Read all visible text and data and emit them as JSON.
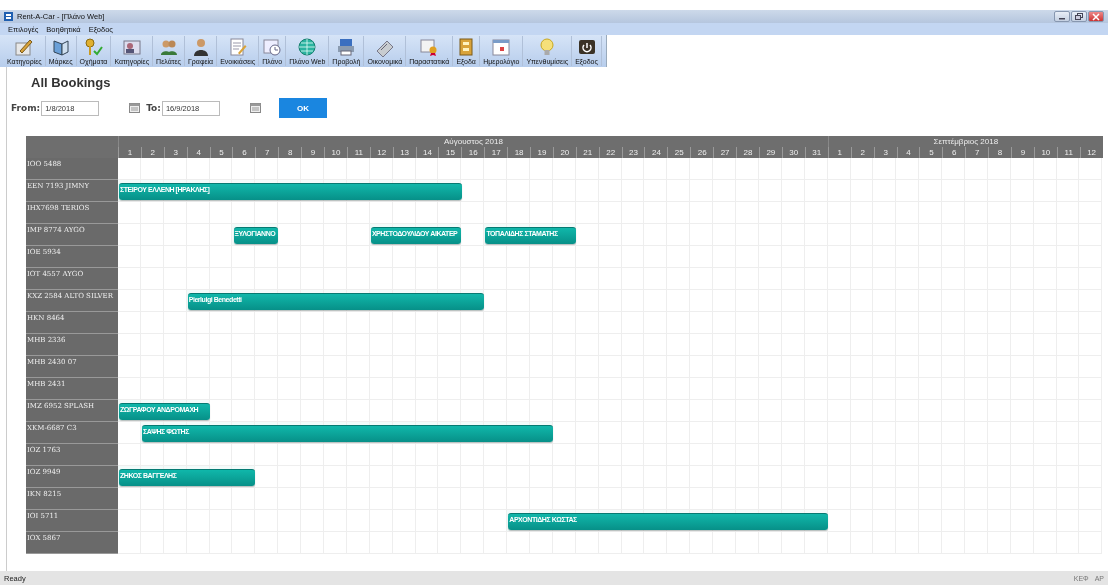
{
  "window": {
    "title": "Rent-A-Car - [Πλάνο Web]"
  },
  "menu": [
    "Επιλογές",
    "Βοηθητικά",
    "Εξοδος"
  ],
  "toolbar": [
    "Κατηγορίες",
    "Μάρκες",
    "Οχήματα",
    "Κατηγορίες",
    "Πελάτες",
    "Γραφεία",
    "Ενοικιάσεις",
    "Πλάνο",
    "Πλάνο Web",
    "Προβολή",
    "Οικονομικά",
    "Παραστατικά",
    "Εξοδα",
    "Ημερολόγιο",
    "Υπενθυμίσεις",
    "Εξοδος"
  ],
  "page": {
    "title": "All Bookings"
  },
  "filter": {
    "from_label": "From:",
    "from_value": "1/8/2018",
    "to_label": "To:",
    "to_value": "16/9/2018",
    "ok_button": "OK"
  },
  "schedule": {
    "months": [
      {
        "label": "Αύγουστος 2018",
        "days": [
          "1",
          "2",
          "3",
          "4",
          "5",
          "6",
          "7",
          "8",
          "9",
          "10",
          "11",
          "12",
          "13",
          "14",
          "15",
          "16",
          "17",
          "18",
          "19",
          "20",
          "21",
          "22",
          "23",
          "24",
          "25",
          "26",
          "27",
          "28",
          "29",
          "30",
          "31"
        ]
      },
      {
        "label": "Σεπτέμβριος 2018",
        "days": [
          "1",
          "2",
          "3",
          "4",
          "5",
          "6",
          "7",
          "8",
          "9",
          "10",
          "11",
          "12"
        ]
      }
    ],
    "rows": [
      {
        "vehicle": "IOO 5488",
        "bookings": [],
        "booked_days": [
          false,
          false,
          false,
          false,
          false,
          false,
          false,
          false,
          false,
          false,
          false,
          false,
          false,
          false,
          false,
          false,
          false,
          false,
          false,
          false,
          false,
          false,
          false,
          false,
          false,
          false,
          false,
          false,
          false,
          false,
          false,
          false,
          false,
          false,
          false,
          false,
          false,
          false,
          false,
          false,
          false,
          false,
          false
        ]
      },
      {
        "vehicle": "EEN 7193 JIMNY",
        "bookings": [
          {
            "customer": "ΣΤΕΙΡΟΥ ΕΛΛΕΝΗ [ΗΡΑΚΛΗΣ]"
          }
        ],
        "booked_days": [
          true,
          true,
          true,
          true,
          true,
          true,
          true,
          true,
          true,
          true,
          true,
          true,
          true,
          true,
          true,
          false,
          false,
          false,
          false,
          false,
          false,
          false,
          false,
          false,
          false,
          false,
          false,
          false,
          false,
          false,
          false,
          false,
          false,
          false,
          false,
          false,
          false,
          false,
          false,
          false,
          false,
          false,
          false
        ]
      },
      {
        "vehicle": "IHX7698 TERIOS",
        "bookings": [],
        "booked_days": [
          false,
          false,
          false,
          false,
          false,
          false,
          false,
          false,
          false,
          false,
          false,
          false,
          false,
          false,
          false,
          false,
          false,
          false,
          false,
          false,
          false,
          false,
          false,
          false,
          false,
          false,
          false,
          false,
          false,
          false,
          false,
          false,
          false,
          false,
          false,
          false,
          false,
          false,
          false,
          false,
          false,
          false,
          false
        ]
      },
      {
        "vehicle": "IMP 8774 AYGO",
        "bookings": [
          {
            "customer": "ΞΥΛΟΓΙΑΝΝΟ"
          },
          {
            "customer": "ΧΡΗΣΤΟΔΟΥΛΙΔΟΥ ΑΙΚΑΤΕΡ"
          },
          {
            "customer": "ΤΟΠΑΛΙΔΗΣ ΣΤΑΜΑΤΗΣ"
          }
        ],
        "booked_days": [
          false,
          false,
          false,
          false,
          false,
          true,
          true,
          false,
          false,
          false,
          false,
          true,
          true,
          true,
          true,
          false,
          true,
          true,
          true,
          true,
          false,
          false,
          false,
          false,
          false,
          false,
          false,
          false,
          false,
          false,
          false,
          false,
          false,
          false,
          false,
          false,
          false,
          false,
          false,
          false,
          false,
          false,
          false
        ]
      },
      {
        "vehicle": "IOE 5934",
        "bookings": [],
        "booked_days": [
          false,
          false,
          false,
          false,
          false,
          false,
          false,
          false,
          false,
          false,
          false,
          false,
          false,
          false,
          false,
          false,
          false,
          false,
          false,
          false,
          false,
          false,
          false,
          false,
          false,
          false,
          false,
          false,
          false,
          false,
          false,
          false,
          false,
          false,
          false,
          false,
          false,
          false,
          false,
          false,
          false,
          false,
          false
        ]
      },
      {
        "vehicle": "IOT 4557 AYGO",
        "bookings": [],
        "booked_days": [
          false,
          false,
          false,
          false,
          false,
          false,
          false,
          false,
          false,
          false,
          false,
          false,
          false,
          false,
          false,
          false,
          false,
          false,
          false,
          false,
          false,
          false,
          false,
          false,
          false,
          false,
          false,
          false,
          false,
          false,
          false,
          false,
          false,
          false,
          false,
          false,
          false,
          false,
          false,
          false,
          false,
          false,
          false
        ]
      },
      {
        "vehicle": "KXZ 2584 ALTO SILVER",
        "bookings": [
          {
            "customer": "Pierluigi Benedetti"
          }
        ],
        "booked_days": [
          false,
          false,
          false,
          true,
          true,
          true,
          true,
          true,
          true,
          true,
          true,
          true,
          true,
          true,
          true,
          true,
          false,
          false,
          false,
          false,
          false,
          false,
          false,
          false,
          false,
          false,
          false,
          false,
          false,
          false,
          false,
          false,
          false,
          false,
          false,
          false,
          false,
          false,
          false,
          false,
          false,
          false,
          false
        ]
      },
      {
        "vehicle": "HKN 8464",
        "bookings": [],
        "booked_days": [
          false,
          false,
          false,
          false,
          false,
          false,
          false,
          false,
          false,
          false,
          false,
          false,
          false,
          false,
          false,
          false,
          false,
          false,
          false,
          false,
          false,
          false,
          false,
          false,
          false,
          false,
          false,
          false,
          false,
          false,
          false,
          false,
          false,
          false,
          false,
          false,
          false,
          false,
          false,
          false,
          false,
          false,
          false
        ]
      },
      {
        "vehicle": "MHB 2336",
        "bookings": [],
        "booked_days": [
          false,
          false,
          false,
          false,
          false,
          false,
          false,
          false,
          false,
          false,
          false,
          false,
          false,
          false,
          false,
          false,
          false,
          false,
          false,
          false,
          false,
          false,
          false,
          false,
          false,
          false,
          false,
          false,
          false,
          false,
          false,
          false,
          false,
          false,
          false,
          false,
          false,
          false,
          false,
          false,
          false,
          false,
          false
        ]
      },
      {
        "vehicle": "MHB 2430 07",
        "bookings": [],
        "booked_days": [
          false,
          false,
          false,
          false,
          false,
          false,
          false,
          false,
          false,
          false,
          false,
          false,
          false,
          false,
          false,
          false,
          false,
          false,
          false,
          false,
          false,
          false,
          false,
          false,
          false,
          false,
          false,
          false,
          false,
          false,
          false,
          false,
          false,
          false,
          false,
          false,
          false,
          false,
          false,
          false,
          false,
          false,
          false
        ]
      },
      {
        "vehicle": "MHB 2431",
        "bookings": [],
        "booked_days": [
          false,
          false,
          false,
          false,
          false,
          false,
          false,
          false,
          false,
          false,
          false,
          false,
          false,
          false,
          false,
          false,
          false,
          false,
          false,
          false,
          false,
          false,
          false,
          false,
          false,
          false,
          false,
          false,
          false,
          false,
          false,
          false,
          false,
          false,
          false,
          false,
          false,
          false,
          false,
          false,
          false,
          false,
          false
        ]
      },
      {
        "vehicle": "IMZ 6952 SPLASH",
        "bookings": [
          {
            "customer": "ΖΩΓΡΑΦΟΥ ΑΝΔΡΟΜΑΧΗ"
          }
        ],
        "booked_days": [
          true,
          true,
          true,
          true,
          false,
          false,
          false,
          false,
          false,
          false,
          false,
          false,
          false,
          false,
          false,
          false,
          false,
          false,
          false,
          false,
          false,
          false,
          false,
          false,
          false,
          false,
          false,
          false,
          false,
          false,
          false,
          false,
          false,
          false,
          false,
          false,
          false,
          false,
          false,
          false,
          false,
          false,
          false
        ]
      },
      {
        "vehicle": "XKM-6687 C3",
        "bookings": [
          {
            "customer": "ΣΑΨΗΣ ΦΩΤΗΣ"
          }
        ],
        "booked_days": [
          false,
          true,
          true,
          true,
          true,
          true,
          true,
          true,
          true,
          true,
          true,
          true,
          true,
          true,
          true,
          true,
          true,
          true,
          true,
          false,
          false,
          false,
          false,
          false,
          false,
          false,
          false,
          false,
          false,
          false,
          false,
          false,
          false,
          false,
          false,
          false,
          false,
          false,
          false,
          false,
          false,
          false,
          false
        ]
      },
      {
        "vehicle": "IOZ 1763",
        "bookings": [],
        "booked_days": [
          false,
          false,
          false,
          false,
          false,
          false,
          false,
          false,
          false,
          false,
          false,
          false,
          false,
          false,
          false,
          false,
          false,
          false,
          false,
          false,
          false,
          false,
          false,
          false,
          false,
          false,
          false,
          false,
          false,
          false,
          false,
          false,
          false,
          false,
          false,
          false,
          false,
          false,
          false,
          false,
          false,
          false,
          false
        ]
      },
      {
        "vehicle": "IOZ 9949",
        "bookings": [
          {
            "customer": "ΖΗΚΟΣ ΒΑΓΓΕΛΗΣ"
          }
        ],
        "booked_days": [
          true,
          true,
          true,
          true,
          true,
          true,
          false,
          false,
          false,
          false,
          false,
          false,
          false,
          false,
          false,
          false,
          false,
          false,
          false,
          false,
          false,
          false,
          false,
          false,
          false,
          false,
          false,
          false,
          false,
          false,
          false,
          false,
          false,
          false,
          false,
          false,
          false,
          false,
          false,
          false,
          false,
          false,
          false
        ]
      },
      {
        "vehicle": "IKN 8215",
        "bookings": [],
        "booked_days": [
          false,
          false,
          false,
          false,
          false,
          false,
          false,
          false,
          false,
          false,
          false,
          false,
          false,
          false,
          false,
          false,
          false,
          false,
          false,
          false,
          false,
          false,
          false,
          false,
          false,
          false,
          false,
          false,
          false,
          false,
          false,
          false,
          false,
          false,
          false,
          false,
          false,
          false,
          false,
          false,
          false,
          false,
          false
        ]
      },
      {
        "vehicle": "IOI 5711",
        "bookings": [
          {
            "customer": "ΑΡΧΟΝΤΙΔΗΣ ΚΩΣΤΑΣ"
          }
        ],
        "booked_days": [
          false,
          false,
          false,
          false,
          false,
          false,
          false,
          false,
          false,
          false,
          false,
          false,
          false,
          false,
          false,
          false,
          false,
          true,
          true,
          true,
          true,
          true,
          true,
          true,
          true,
          true,
          true,
          true,
          true,
          true,
          true,
          false,
          false,
          false,
          false,
          false,
          false,
          false,
          false,
          false,
          false,
          false,
          false
        ]
      },
      {
        "vehicle": "IOX 5867",
        "bookings": [],
        "booked_days": [
          false,
          false,
          false,
          false,
          false,
          false,
          false,
          false,
          false,
          false,
          false,
          false,
          false,
          false,
          false,
          false,
          false,
          false,
          false,
          false,
          false,
          false,
          false,
          false,
          false,
          false,
          false,
          false,
          false,
          false,
          false,
          false,
          false,
          false,
          false,
          false,
          false,
          false,
          false,
          false,
          false,
          false,
          false
        ]
      }
    ]
  },
  "status_bar": {
    "text": "Ready",
    "indicators": [
      "ΚΕΦ",
      "ΑΡ"
    ]
  }
}
